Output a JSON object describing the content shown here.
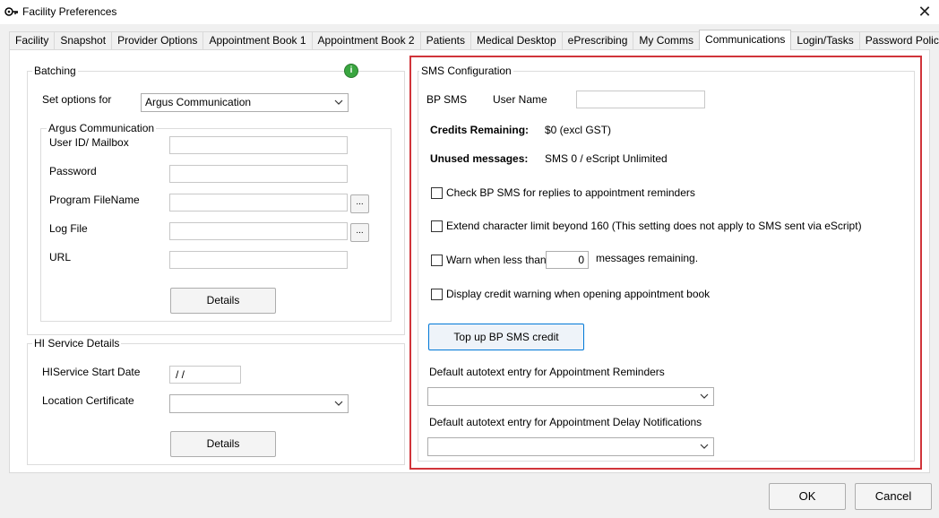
{
  "window": {
    "title": "Facility Preferences"
  },
  "tabs": [
    "Facility",
    "Snapshot",
    "Provider Options",
    "Appointment Book 1",
    "Appointment Book 2",
    "Patients",
    "Medical Desktop",
    "ePrescribing",
    "My Comms",
    "Communications",
    "Login/Tasks",
    "Password Policy"
  ],
  "active_tab": "Communications",
  "batching": {
    "group_label": "Batching",
    "set_options_label": "Set options for",
    "set_options_value": "Argus Communication",
    "argus": {
      "group_label": "Argus Communication",
      "user_id_label": "User ID/ Mailbox",
      "password_label": "Password",
      "program_label": "Program FileName",
      "logfile_label": "Log File",
      "url_label": "URL",
      "browse_label": "...",
      "details_label": "Details"
    }
  },
  "hi_service": {
    "group_label": "HI Service Details",
    "start_date_label": "HIService Start Date",
    "start_date_value": " /  /",
    "location_cert_label": "Location Certificate",
    "details_label": "Details"
  },
  "sms": {
    "group_label": "SMS Configuration",
    "bp_sms_label": "BP SMS",
    "user_name_label": "User Name",
    "credits_label": "Credits Remaining:",
    "credits_value": "$0 (excl GST)",
    "unused_label": "Unused messages:",
    "unused_value": "SMS 0 / eScript Unlimited",
    "check_replies_label": "Check BP SMS for replies to appointment reminders",
    "extend_limit_label": "Extend character limit beyond 160 (This setting does not apply to SMS sent via eScript)",
    "warn_label": "Warn when less than",
    "warn_value": "0",
    "warn_suffix": "messages remaining.",
    "display_warning_label": "Display credit warning when opening appointment book",
    "topup_label": "Top up BP SMS credit",
    "autotext_reminders_label": "Default autotext entry for Appointment Reminders",
    "autotext_delay_label": "Default autotext entry for Appointment Delay Notifications"
  },
  "footer": {
    "ok_label": "OK",
    "cancel_label": "Cancel"
  },
  "colors": {
    "highlight_border": "#d0343a",
    "info_icon": "#3aa640"
  }
}
